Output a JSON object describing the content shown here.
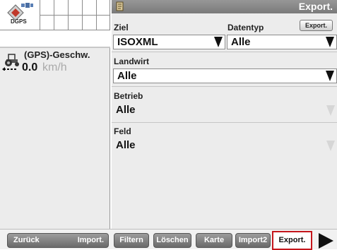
{
  "status": {
    "dgps_label": "DGPS"
  },
  "speed": {
    "title": "(GPS)-Geschw.",
    "value": "0.0",
    "unit": "km/h"
  },
  "header": {
    "title": "Export."
  },
  "form": {
    "ziel": {
      "label": "Ziel",
      "value": "ISOXML"
    },
    "datentyp": {
      "label": "Datentyp",
      "value": "Alle"
    },
    "export_button": "Export.",
    "landwirt": {
      "label": "Landwirt",
      "value": "Alle"
    },
    "betrieb": {
      "label": "Betrieb",
      "value": "Alle"
    },
    "feld": {
      "label": "Feld",
      "value": "Alle"
    }
  },
  "bottom_bar": {
    "back": "Zurück",
    "import": "Import.",
    "filter": "Filtern",
    "delete": "Löschen",
    "map": "Karte",
    "import2": "Import2",
    "export": "Export."
  },
  "colors": {
    "active_tab_border": "#c4161c",
    "header_bg": "#8a8a8a"
  }
}
